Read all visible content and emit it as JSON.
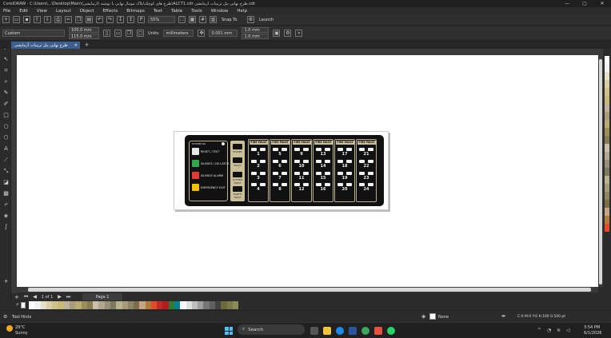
{
  "titlebar": {
    "title": "CorelDRAW - C:\\Users\\...\\Desktop\\Main\\طرح های کوچک\\پلاک مونتاژ نهایی با نوشته (آزمایشی)\\ALCT1.cdr طرح نهایی پنل تزیینات آزمایشی.cdr",
    "minimize": "—",
    "maximize": "▢",
    "close": "✕"
  },
  "menu": [
    "File",
    "Edit",
    "View",
    "Layout",
    "Object",
    "Effects",
    "Bitmaps",
    "Text",
    "Table",
    "Tools",
    "Window",
    "Help"
  ],
  "toolbar1": {
    "zoom": "55%",
    "snap_to": "Snap To",
    "launch": "Launch"
  },
  "toolbar2": {
    "page_preset": "Custom",
    "width": "100.0 mm",
    "height": "115.0 mm",
    "units_label": "Units:",
    "units": "millimeters",
    "nudge": "0.001 mm",
    "dup_x": "1.0 mm",
    "dup_y": "1.0 mm"
  },
  "document_tab": {
    "name": "طرح نهایی پنل تزیینات آزمایشی",
    "close": "✕"
  },
  "pager": {
    "text": "1 of 1",
    "page_tab": "Page 1"
  },
  "palette_colors": [
    "#ffffff",
    "#f2f2f2",
    "#e6e0c8",
    "#d9cfa3",
    "#cfc18a",
    "#c8b97a",
    "#bfb29a",
    "#a89c7d",
    "#b8aa70",
    "#9c8f5c",
    "#877a55",
    "#c8c0a8",
    "#b0a890",
    "#978f78",
    "#7f7860",
    "#b9b28e",
    "#a39c7a",
    "#8c8566",
    "#7d6e4a",
    "#c4a484",
    "#b37b3a",
    "#e34b2a",
    "#c62828",
    "#b71c1c",
    "#2f7d32",
    "#00838f",
    "#ffffff",
    "#e0e0e0",
    "#bdbdbd",
    "#9e9e9e",
    "#757575",
    "#616161",
    "#424242",
    "#6b6b3a",
    "#7b7b4a",
    "#8b8b5a"
  ],
  "status": {
    "tool_hints": "Tool Hints",
    "fill": "None",
    "outline": "C:0 M:0 Y:0 K:100  0.500 pt"
  },
  "taskbar": {
    "weather_temp": "29°C",
    "weather_desc": "Sunny",
    "search_placeholder": "Search",
    "time": "3:54 PM",
    "date": "6/1/2026"
  },
  "design": {
    "left_buttons": [
      {
        "label": "RESET / TEST",
        "color": "#e8e8e8"
      },
      {
        "label": "SILENCE / DE-LATCH",
        "color": "#2fa84f"
      },
      {
        "label": "SILENCE ALARM",
        "color": "#e53935"
      },
      {
        "label": "EMERGENCY EXIT",
        "color": "#f2c200"
      }
    ],
    "left_header": "SYSTEM OK",
    "mid_labels": [
      "POWER",
      "FAULT",
      "SYSTEM FAULT",
      "EARTH FAULT"
    ],
    "column_header": "FIRE FAULT",
    "zones": [
      [
        1,
        5,
        9,
        13,
        17,
        21
      ],
      [
        2,
        6,
        10,
        14,
        18,
        22
      ],
      [
        3,
        7,
        11,
        15,
        19,
        23
      ],
      [
        4,
        8,
        12,
        16,
        20,
        24
      ]
    ]
  }
}
